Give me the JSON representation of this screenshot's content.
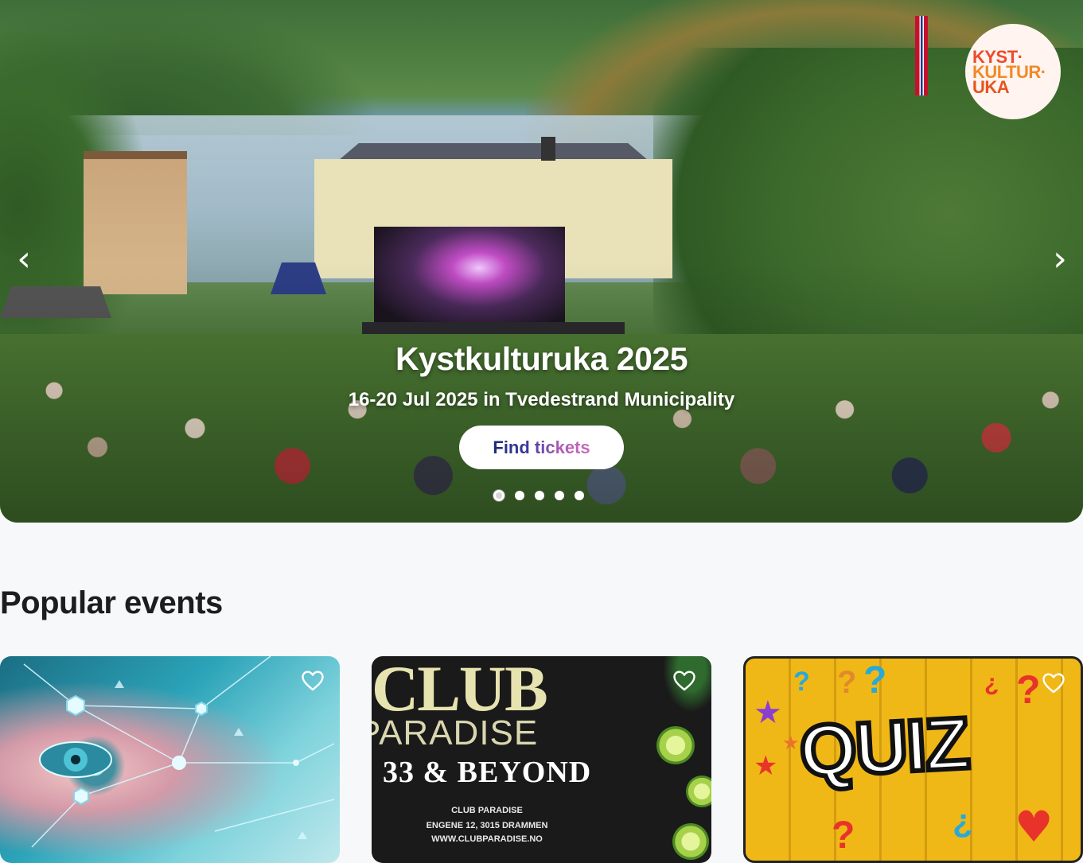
{
  "hero": {
    "logo_lines": [
      "KYST·",
      "KULTUR·",
      "UKA"
    ],
    "title": "Kystkulturuka 2025",
    "subtitle": "16-20 Jul 2025 in Tvedestrand Municipality",
    "cta_label": "Find tickets",
    "prev_arrow": "‹",
    "next_arrow": "›",
    "slide_count": 5,
    "active_slide": 1
  },
  "popular": {
    "title": "Popular events",
    "cards": [
      {
        "image_icon": "digital-eye-network-image"
      },
      {
        "image_icon": "club-paradise-poster",
        "poster_lines": [
          "CLUB",
          "PARADISE",
          "33 & BEYOND",
          "CLUB PARADISE",
          "ENGENE 12, 3015 DRAMMEN",
          "WWW.CLUBPARADISE.NO"
        ]
      },
      {
        "image_icon": "quiz-poster",
        "poster_text": "QUIZ"
      }
    ],
    "favorite_icon": "heart-outline-icon"
  },
  "colors": {
    "page_bg": "#f7f8fa",
    "cta_gradient_start": "#1f2a78",
    "cta_gradient_end": "#c76fb6",
    "logo_orange": "#ee4a2c"
  }
}
